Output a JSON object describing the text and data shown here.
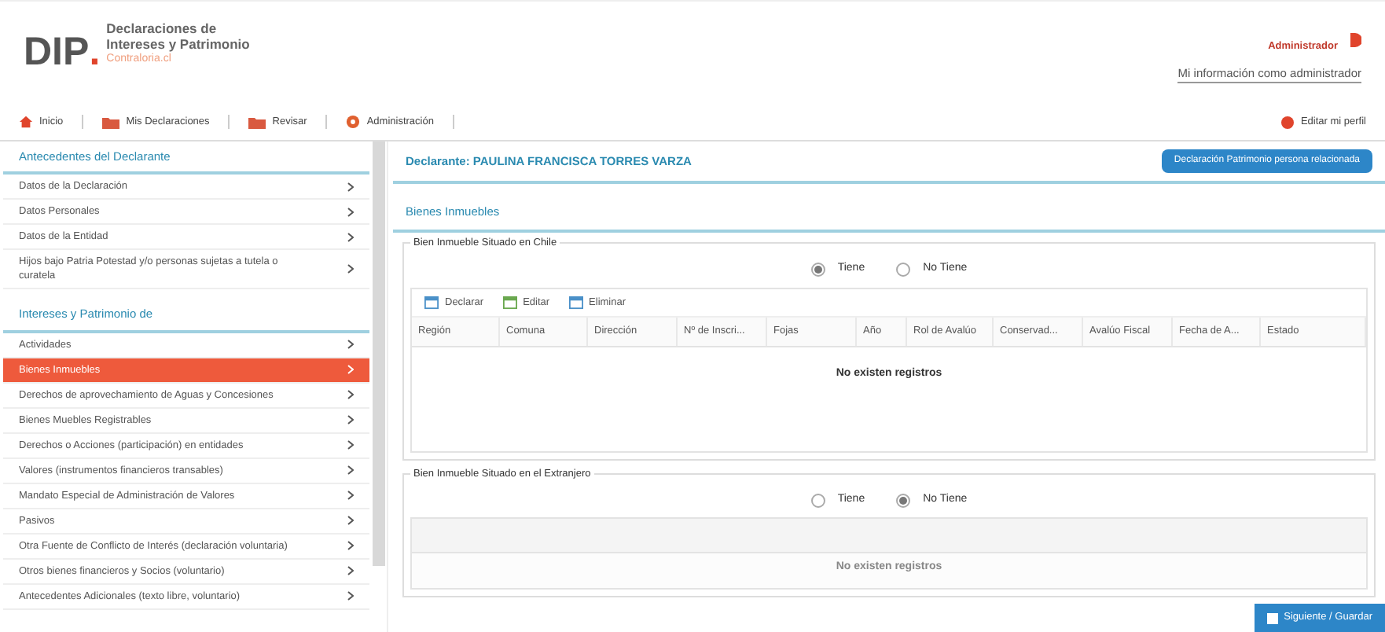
{
  "header": {
    "logo": "DIP",
    "logo_dot": ".",
    "title_lines": [
      "Declaraciones de",
      "Intereses y Patrimonio"
    ],
    "subtitle": "Contraloria.cl",
    "user_role": "Administrador",
    "user_link": "Mi información como administrador"
  },
  "nav": {
    "items": [
      {
        "label": "Inicio",
        "kind": "home"
      },
      {
        "label": "Mis Declaraciones",
        "kind": "folder"
      },
      {
        "label": "Revisar",
        "kind": "folder"
      },
      {
        "label": "Administración",
        "kind": "settings"
      }
    ],
    "profile_link": "Editar mi perfil"
  },
  "sidebar": {
    "sections": [
      {
        "title": "Antecedentes del Declarante",
        "items": [
          {
            "label": "Datos de la Declaración",
            "selected": false
          },
          {
            "label": "Datos Personales",
            "selected": false
          },
          {
            "label": "Datos de la Entidad",
            "selected": false
          },
          {
            "label": "Hijos bajo Patria Potestad y/o personas sujetas a tutela o curatela",
            "selected": false
          }
        ]
      },
      {
        "title": "Intereses y Patrimonio de",
        "items": [
          {
            "label": "Actividades",
            "selected": false
          },
          {
            "label": "Bienes Inmuebles",
            "selected": true
          },
          {
            "label": "Derechos de aprovechamiento de Aguas y Concesiones",
            "selected": false
          },
          {
            "label": "Bienes Muebles Registrables",
            "selected": false
          },
          {
            "label": "Derechos o Acciones (participación) en entidades",
            "selected": false
          },
          {
            "label": "Valores (instrumentos financieros transables)",
            "selected": false
          },
          {
            "label": "Mandato Especial de Administración de Valores",
            "selected": false
          },
          {
            "label": "Pasivos",
            "selected": false
          },
          {
            "label": "Otra Fuente de Conflicto de Interés (declaración voluntaria)",
            "selected": false
          },
          {
            "label": "Otros bienes financieros y Socios (voluntario)",
            "selected": false
          },
          {
            "label": "Antecedentes Adicionales (texto libre, voluntario)",
            "selected": false
          }
        ]
      }
    ]
  },
  "main": {
    "declarant": "Declarante: PAULINA FRANCISCA TORRES VARZA",
    "related_button": "Declaración Patrimonio persona relacionada",
    "section_title": "Bienes Inmuebles",
    "groups": [
      {
        "legend": "Bien Inmueble Situado en Chile",
        "options": [
          {
            "label": "Tiene",
            "selected": true
          },
          {
            "label": "No Tiene",
            "selected": false
          }
        ],
        "disabled": false,
        "toolbar": [
          {
            "label": "Declarar",
            "kind": "add"
          },
          {
            "label": "Editar",
            "kind": "edit"
          },
          {
            "label": "Eliminar",
            "kind": "delete"
          }
        ],
        "columns": [
          "Región",
          "Comuna",
          "Dirección",
          "Nº de Inscri...",
          "Fojas",
          "Año",
          "Rol de Avalúo",
          "Conservad...",
          "Avalúo Fiscal",
          "Fecha de A...",
          "Estado"
        ],
        "empty": "No existen registros"
      },
      {
        "legend": "Bien Inmueble Situado en el Extranjero",
        "options": [
          {
            "label": "Tiene",
            "selected": false
          },
          {
            "label": "No Tiene",
            "selected": true
          }
        ],
        "disabled": true,
        "empty": "No existen registros"
      }
    ]
  },
  "footer": {
    "next_button": "Siguiente / Guardar"
  }
}
